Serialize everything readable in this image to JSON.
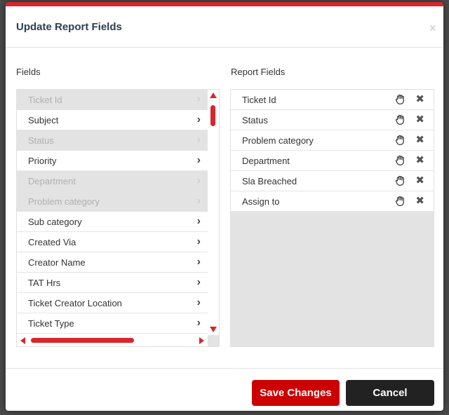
{
  "dialog": {
    "title": "Update Report Fields",
    "close_symbol": "×"
  },
  "fields_panel": {
    "label": "Fields",
    "items": [
      {
        "label": "Ticket Id",
        "disabled": true
      },
      {
        "label": "Subject",
        "disabled": false
      },
      {
        "label": "Status",
        "disabled": true
      },
      {
        "label": "Priority",
        "disabled": false
      },
      {
        "label": "Department",
        "disabled": true
      },
      {
        "label": "Problem category",
        "disabled": true
      },
      {
        "label": "Sub category",
        "disabled": false
      },
      {
        "label": "Created Via",
        "disabled": false
      },
      {
        "label": "Creator Name",
        "disabled": false
      },
      {
        "label": "TAT Hrs",
        "disabled": false
      },
      {
        "label": "Ticket Creator Location",
        "disabled": false
      },
      {
        "label": "Ticket Type",
        "disabled": false
      }
    ],
    "chevron_symbol": "›"
  },
  "report_panel": {
    "label": "Report Fields",
    "items": [
      {
        "label": "Ticket Id"
      },
      {
        "label": "Status"
      },
      {
        "label": "Problem category"
      },
      {
        "label": "Department"
      },
      {
        "label": "Sla Breached"
      },
      {
        "label": "Assign to"
      }
    ],
    "remove_symbol": "✖",
    "drag_icon": "hand-icon"
  },
  "footer": {
    "save_label": "Save Changes",
    "cancel_label": "Cancel"
  },
  "colors": {
    "accent": "#d9262b",
    "save": "#cc0000",
    "cancel": "#222222"
  }
}
